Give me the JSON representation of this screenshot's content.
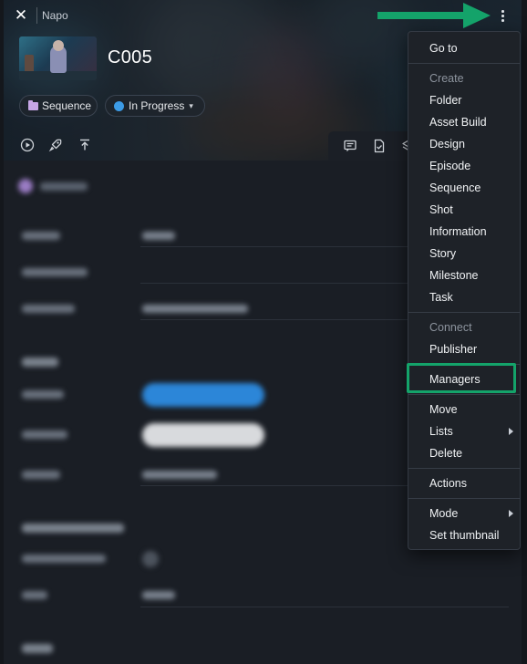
{
  "header": {
    "close_icon": "close-icon",
    "app_title": "Napo",
    "more_icon": "kebab-menu-icon",
    "entity_name": "C005",
    "type_chip": {
      "label": "Sequence",
      "icon": "folder-icon",
      "color": "#c7a6e6"
    },
    "status_chip": {
      "label": "In Progress",
      "icon": "status-dot-icon",
      "color": "#3c9be6",
      "dropdown_icon": "chevron-down-icon"
    },
    "toolbar_icons": [
      "play-icon",
      "rocket-icon",
      "upload-icon"
    ],
    "tab_icons": [
      "comment-icon",
      "document-check-icon",
      "layers-icon"
    ]
  },
  "context_menu": {
    "items": [
      {
        "label": "Go to",
        "kind": "item"
      },
      {
        "label": "Create",
        "kind": "section"
      },
      {
        "label": "Folder",
        "kind": "item"
      },
      {
        "label": "Asset Build",
        "kind": "item"
      },
      {
        "label": "Design",
        "kind": "item"
      },
      {
        "label": "Episode",
        "kind": "item"
      },
      {
        "label": "Sequence",
        "kind": "item"
      },
      {
        "label": "Shot",
        "kind": "item"
      },
      {
        "label": "Information",
        "kind": "item"
      },
      {
        "label": "Story",
        "kind": "item"
      },
      {
        "label": "Milestone",
        "kind": "item"
      },
      {
        "label": "Task",
        "kind": "item"
      },
      {
        "label": "Connect",
        "kind": "section"
      },
      {
        "label": "Publisher",
        "kind": "item"
      },
      {
        "label": "Managers",
        "kind": "item",
        "highlighted": true
      },
      {
        "label": "Move",
        "kind": "item"
      },
      {
        "label": "Lists",
        "kind": "item",
        "has_submenu": true
      },
      {
        "label": "Delete",
        "kind": "item"
      },
      {
        "label": "Actions",
        "kind": "item"
      },
      {
        "label": "Mode",
        "kind": "item",
        "has_submenu": true
      },
      {
        "label": "Set thumbnail",
        "kind": "item"
      }
    ]
  },
  "annotations": {
    "highlight_color": "#14a36a",
    "arrow_color": "#14a36a"
  }
}
